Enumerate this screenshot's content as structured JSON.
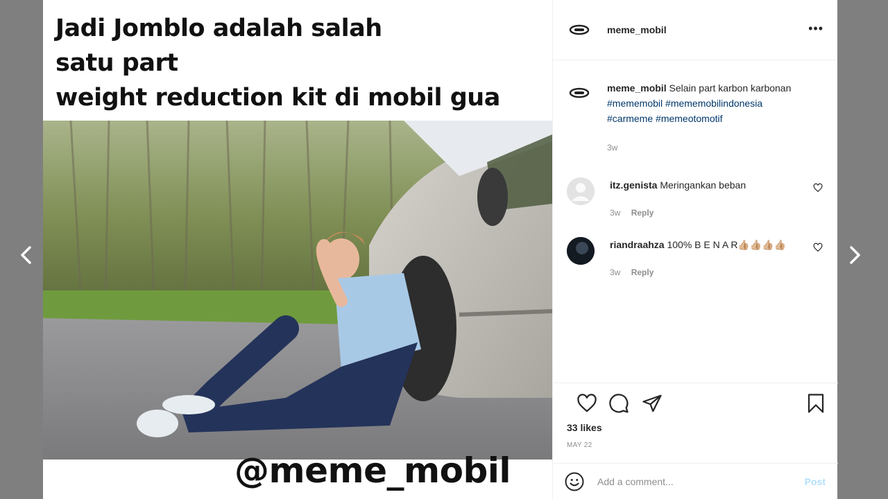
{
  "post": {
    "meme_caption_lines": [
      "Jadi Jomblo adalah salah",
      "satu part",
      "weight reduction kit di mobil gua"
    ],
    "watermark": "@meme_mobil"
  },
  "header": {
    "username": "meme_mobil",
    "more_icon": "more-horizontal-icon",
    "more_label": "•••"
  },
  "caption": {
    "username": "meme_mobil",
    "text": "Selain part karbon karbonan",
    "hashtags": [
      "#mememobil",
      "#mememobilindonesia",
      "#carmeme",
      "#memeotomotif"
    ],
    "time": "3w"
  },
  "comments": [
    {
      "username": "itz.genista",
      "text": "Meringankan beban",
      "time": "3w",
      "reply_label": "Reply"
    },
    {
      "username": "riandraahza",
      "text": "100% B E N A R👍🏼👍🏼👍🏼👍🏼",
      "time": "3w",
      "reply_label": "Reply"
    }
  ],
  "actions": {
    "likes": "33 likes",
    "date": "MAY 22"
  },
  "add_comment": {
    "placeholder": "Add a comment...",
    "post_label": "Post"
  },
  "colors": {
    "hashtag": "#00376b",
    "post_button_disabled": "#b2dffc",
    "muted": "#8e8e8e",
    "text": "#262626"
  }
}
